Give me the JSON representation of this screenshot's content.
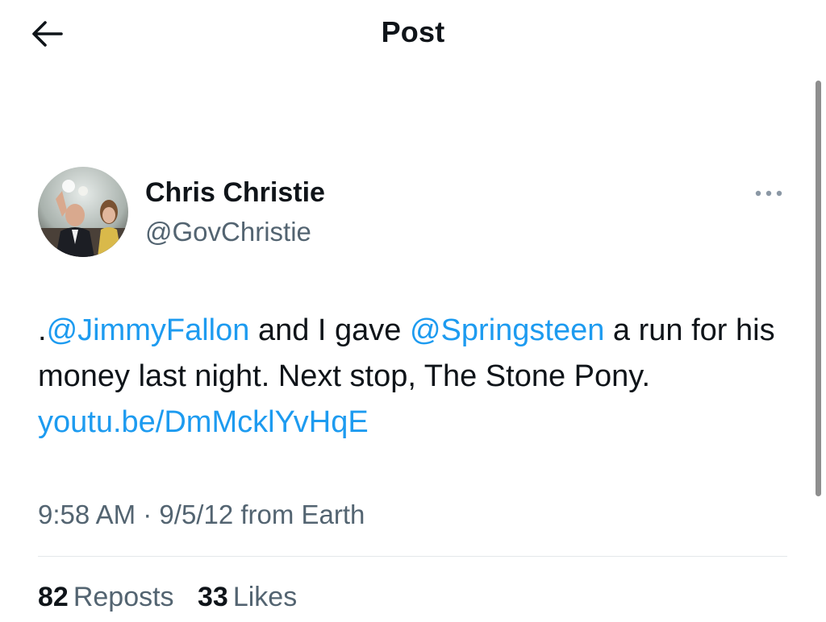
{
  "header": {
    "title": "Post",
    "back_icon": "arrow-left-icon"
  },
  "author": {
    "name": "Chris Christie",
    "handle": "@GovChristie",
    "avatar_icon": "profile-photo",
    "more_icon": "more-options-icon"
  },
  "tweet": {
    "prefix": ".",
    "mention1": "@JimmyFallon",
    "text1": " and I gave ",
    "mention2": "@Springsteen",
    "text2": " a run for his money last night. Next stop, The Stone Pony. ",
    "link": "youtu.be/DmMcklYvHqE"
  },
  "meta": {
    "time": "9:58 AM",
    "separator": "·",
    "date": "9/5/12",
    "source": "from Earth"
  },
  "stats": {
    "reposts_count": "82",
    "reposts_label": "Reposts",
    "likes_count": "33",
    "likes_label": "Likes"
  },
  "colors": {
    "link": "#1d9bf0",
    "secondary_text": "#536471",
    "primary_text": "#0f1419"
  }
}
